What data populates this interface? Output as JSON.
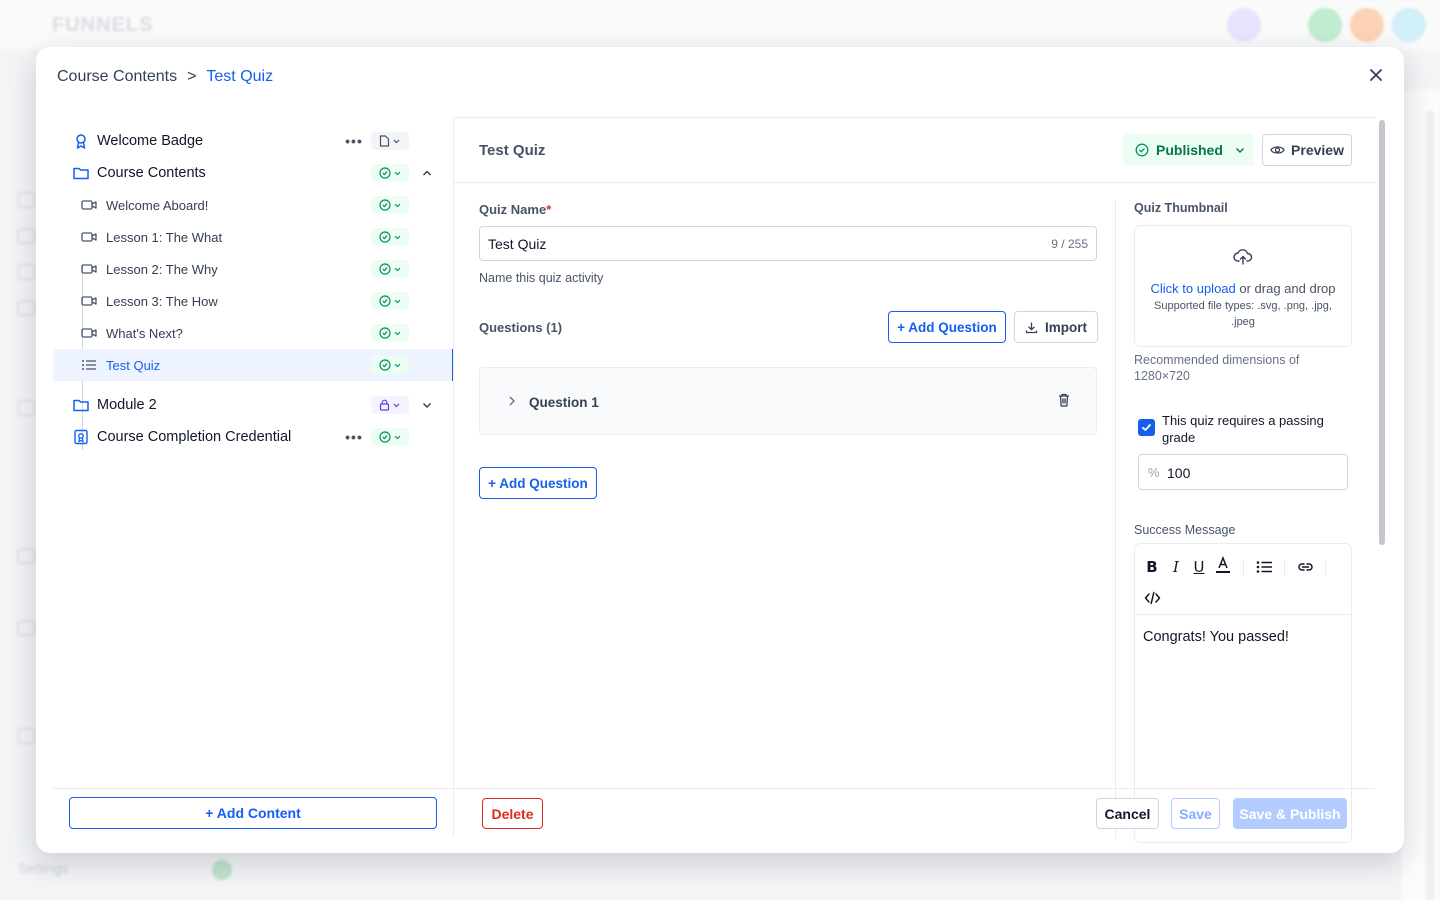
{
  "background": {
    "logo_text": "FUNNELS",
    "settings_label": "Settings"
  },
  "breadcrumb": {
    "root": "Course Contents",
    "separator": ">",
    "current": "Test Quiz"
  },
  "tree": {
    "items": [
      {
        "label": "Welcome Badge",
        "icon": "badge-icon",
        "status": "draft"
      },
      {
        "label": "Course Contents",
        "icon": "folder-icon",
        "status": "published",
        "expanded": true
      },
      {
        "label": "Welcome Aboard!",
        "icon": "video-icon",
        "status": "published"
      },
      {
        "label": "Lesson 1: The What",
        "icon": "video-icon",
        "status": "published"
      },
      {
        "label": "Lesson 2: The Why",
        "icon": "video-icon",
        "status": "published"
      },
      {
        "label": "Lesson 3: The How",
        "icon": "video-icon",
        "status": "published"
      },
      {
        "label": "What's Next?",
        "icon": "video-icon",
        "status": "published"
      },
      {
        "label": "Test Quiz",
        "icon": "list-icon",
        "status": "published",
        "active": true
      },
      {
        "label": "Module 2",
        "icon": "folder-icon",
        "status": "locked",
        "expanded": false
      },
      {
        "label": "Course Completion Credential",
        "icon": "credential-icon",
        "status": "published"
      }
    ],
    "add_content_label": "+ Add Content"
  },
  "pane": {
    "title": "Test Quiz",
    "status_label": "Published",
    "preview_label": "Preview"
  },
  "quiz": {
    "name_label": "Quiz Name",
    "required_mark": "*",
    "name_value": "Test Quiz",
    "name_count": "9 / 255",
    "name_hint": "Name this quiz activity",
    "questions_label": "Questions (1)",
    "add_question_label": "+ Add Question",
    "import_label": "Import",
    "questions": [
      {
        "label": "Question 1"
      }
    ]
  },
  "thumbnail": {
    "label": "Quiz Thumbnail",
    "upload_link": "Click to upload",
    "upload_rest": " or drag and drop",
    "file_types": "Supported file types: .svg, .png, .jpg, .jpeg",
    "recommended": "Recommended dimensions of 1280×720"
  },
  "passing": {
    "checked": true,
    "label": "This quiz requires a passing grade",
    "percent_symbol": "%",
    "value": "100"
  },
  "success": {
    "label": "Success Message",
    "content": "Congrats! You passed!"
  },
  "footer": {
    "delete_label": "Delete",
    "cancel_label": "Cancel",
    "save_label": "Save",
    "publish_label": "Save & Publish"
  },
  "colors": {
    "accent": "#155eef",
    "published_bg": "#ecfdf3",
    "published_text": "#067647",
    "danger": "#d92d20"
  }
}
